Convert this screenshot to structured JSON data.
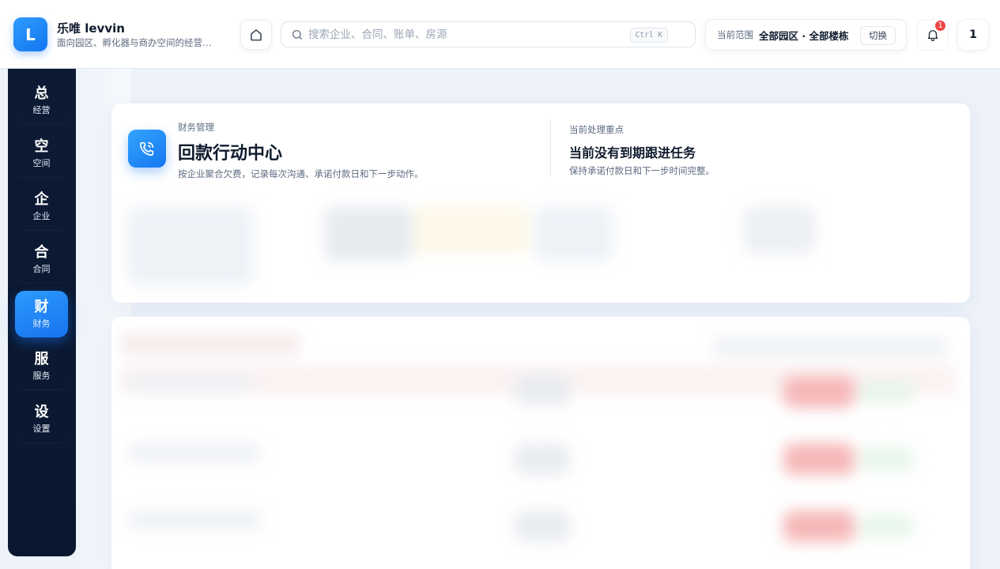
{
  "brand": {
    "logo_letter": "L",
    "name": "乐唯 levvin",
    "subtitle": "面向园区、孵化器与商办空间的经营…"
  },
  "header": {
    "search_placeholder": "搜索企业、合同、账单、房源",
    "search_shortcut": "Ctrl K",
    "scope_label": "当前范围",
    "scope_value": "全部园区 · 全部楼栋",
    "scope_switch": "切换",
    "notification_count": "1",
    "user_initial": "1"
  },
  "sidebar": {
    "items": [
      {
        "glyph": "总",
        "label": "经营",
        "active": false
      },
      {
        "glyph": "空",
        "label": "空间",
        "active": false
      },
      {
        "glyph": "企",
        "label": "企业",
        "active": false
      },
      {
        "glyph": "合",
        "label": "合同",
        "active": false
      },
      {
        "glyph": "财",
        "label": "财务",
        "active": true
      },
      {
        "glyph": "服",
        "label": "服务",
        "active": false
      },
      {
        "glyph": "设",
        "label": "设置",
        "active": false
      }
    ]
  },
  "hero": {
    "kicker": "财务管理",
    "title": "回款行动中心",
    "description": "按企业聚合欠费，记录每次沟通、承诺付款日和下一步动作。",
    "focus_kicker": "当前处理重点",
    "focus_title": "当前没有到期跟进任务",
    "focus_description": "保持承诺付款日和下一步时间完整。"
  },
  "icons": {
    "home": "home-icon",
    "search": "search-icon",
    "bell": "bell-icon",
    "hero": "phone-call-icon"
  },
  "colors": {
    "accent": "#1677f0",
    "sidebar_bg": "#0b1832",
    "badge": "#ef4444"
  }
}
